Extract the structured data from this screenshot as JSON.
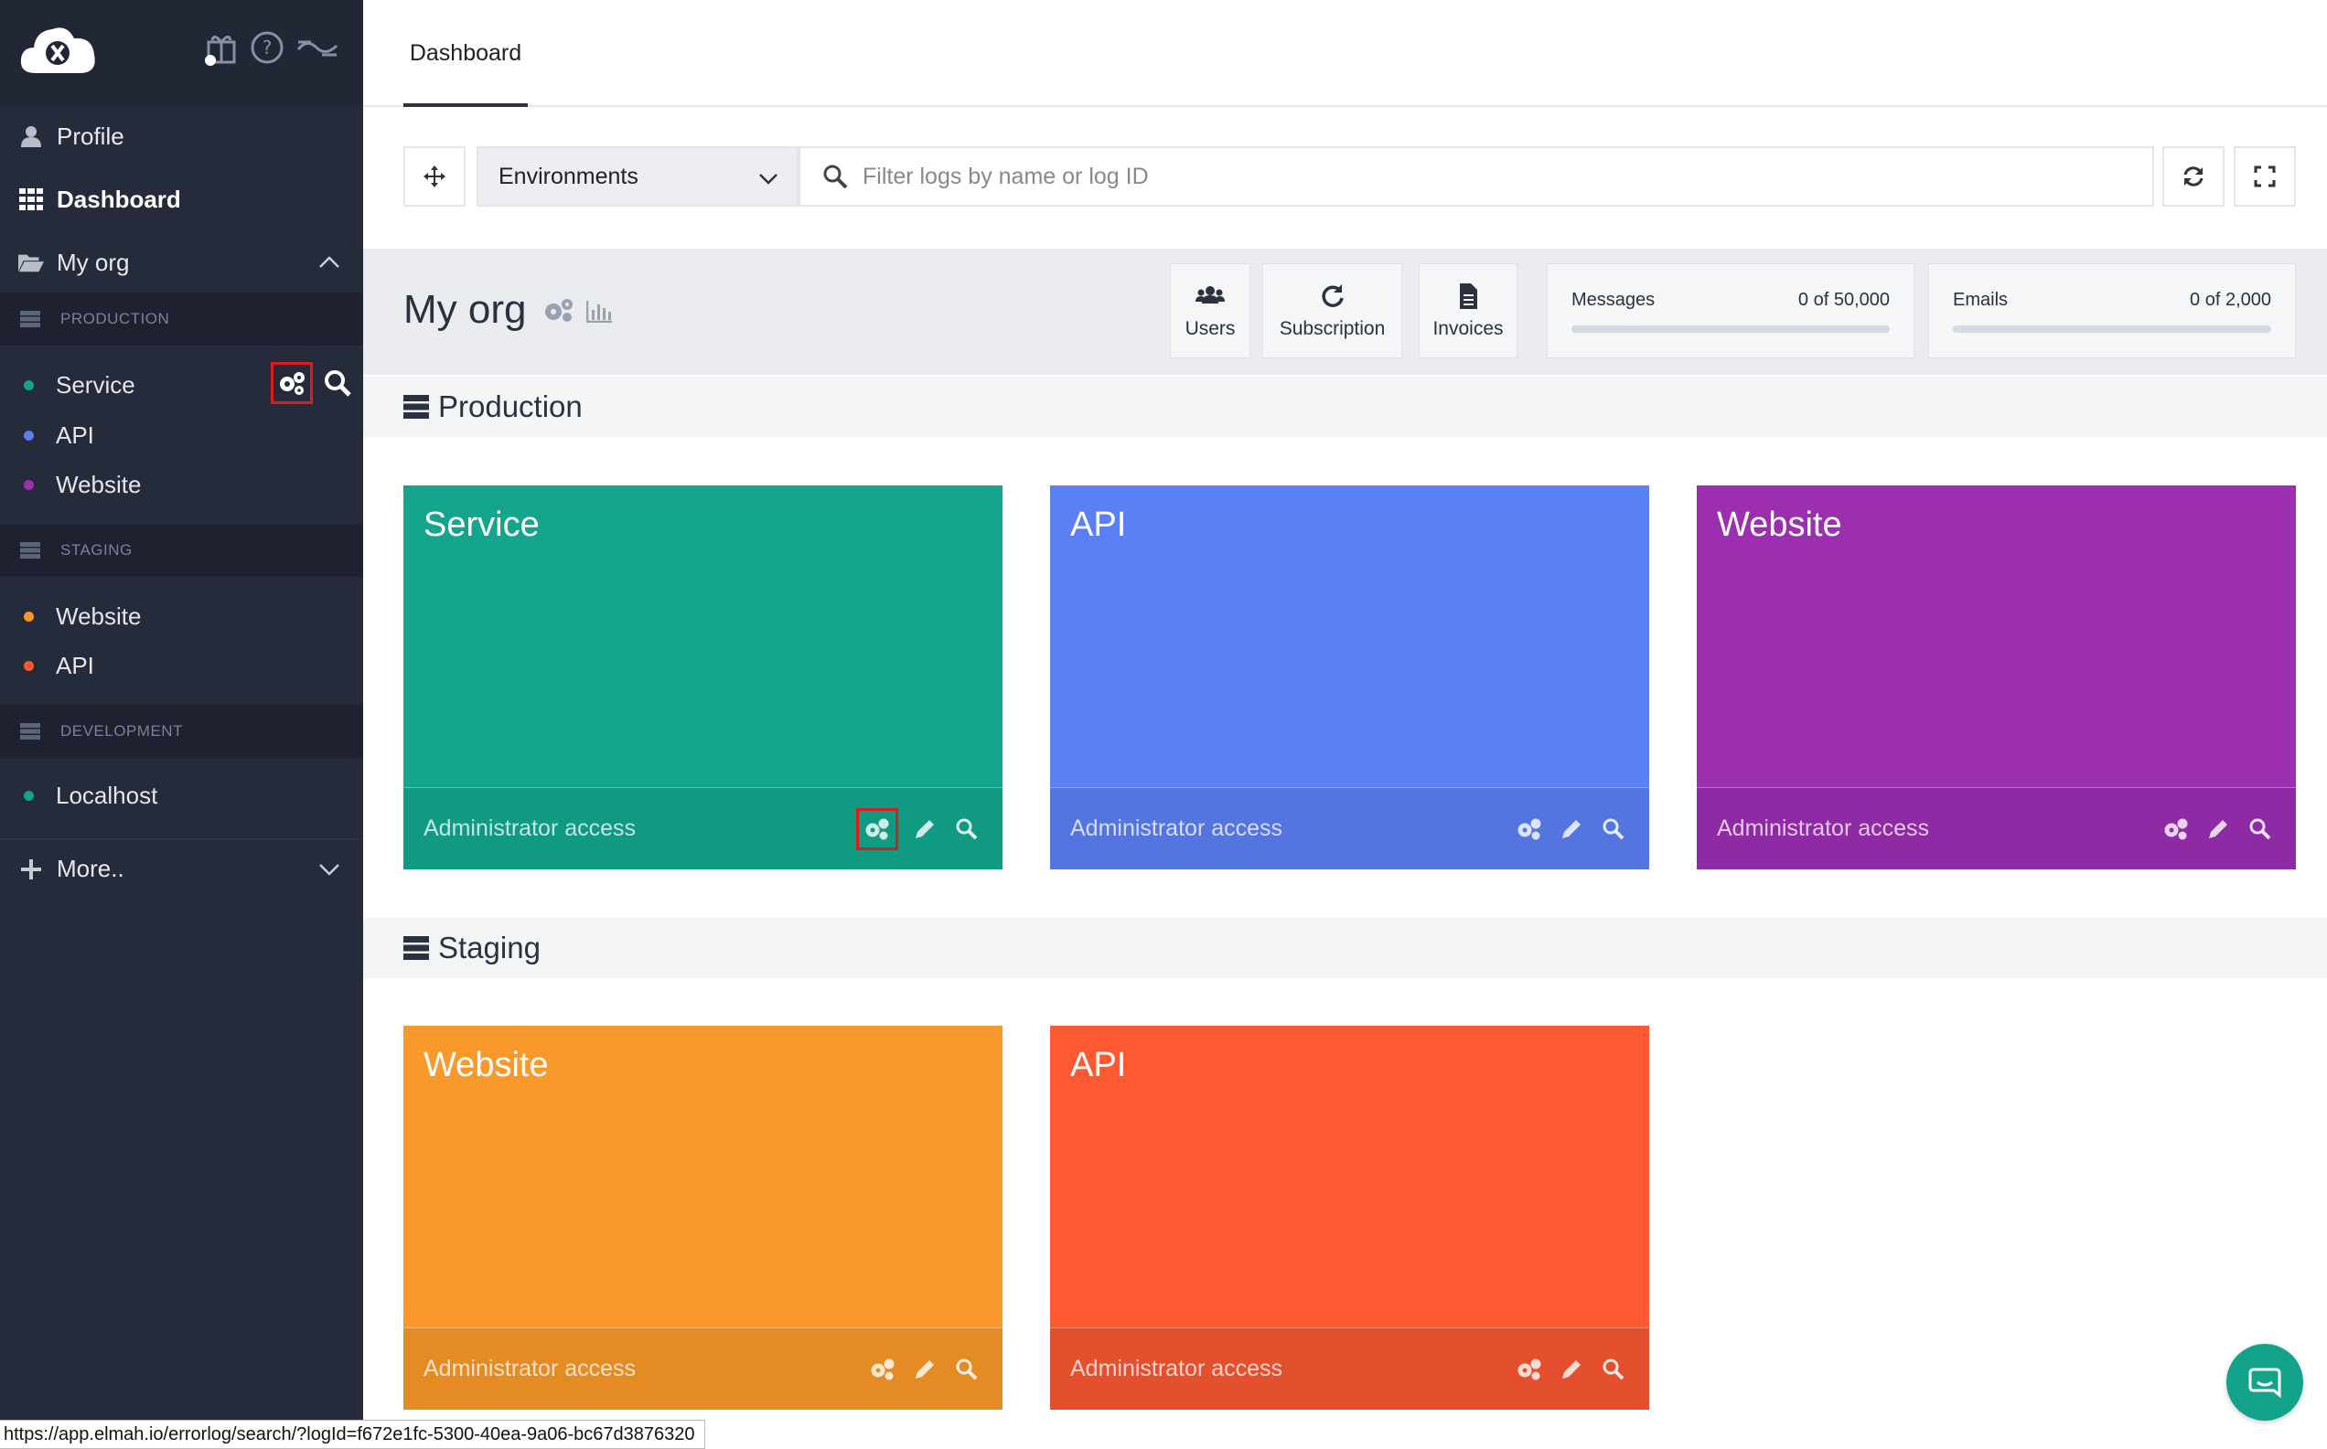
{
  "sidebar": {
    "items": [
      {
        "label": "Profile"
      },
      {
        "label": "Dashboard"
      },
      {
        "label": "My org"
      },
      {
        "label": "More.."
      }
    ],
    "sections": [
      {
        "label": "PRODUCTION",
        "envs": [
          {
            "label": "Service",
            "color": "#13a38a"
          },
          {
            "label": "API",
            "color": "#5b7ff0"
          },
          {
            "label": "Website",
            "color": "#9b30b0"
          }
        ]
      },
      {
        "label": "STAGING",
        "envs": [
          {
            "label": "Website",
            "color": "#f7962a"
          },
          {
            "label": "API",
            "color": "#f25a33"
          }
        ]
      },
      {
        "label": "DEVELOPMENT",
        "envs": [
          {
            "label": "Localhost",
            "color": "#13a38a"
          }
        ]
      }
    ]
  },
  "header": {
    "tab": "Dashboard"
  },
  "toolbar": {
    "environments": "Environments",
    "search_placeholder": "Filter logs by name or log ID"
  },
  "org": {
    "name": "My org",
    "buttons": {
      "users": "Users",
      "subscription": "Subscription",
      "invoices": "Invoices"
    },
    "usage": [
      {
        "label": "Messages",
        "value": "0 of 50,000",
        "fraction": 0
      },
      {
        "label": "Emails",
        "value": "0 of 2,000",
        "fraction": 0
      }
    ]
  },
  "groups": [
    {
      "title": "Production",
      "cards": [
        {
          "title": "Service",
          "access": "Administrator access",
          "color": "#13a68c",
          "footer_color": "#119a82"
        },
        {
          "title": "API",
          "access": "Administrator access",
          "color": "#5b7ff5",
          "footer_color": "#5474e0"
        },
        {
          "title": "Website",
          "access": "Administrator access",
          "color": "#9c2fb0",
          "footer_color": "#8e2aa3"
        }
      ]
    },
    {
      "title": "Staging",
      "cards": [
        {
          "title": "Website",
          "access": "Administrator access",
          "color": "#f9992b",
          "footer_color": "#e58b24"
        },
        {
          "title": "API",
          "access": "Administrator access",
          "color": "#fe5a32",
          "footer_color": "#e4502d"
        }
      ]
    }
  ],
  "status_url": "https://app.elmah.io/errorlog/search/?logId=f672e1fc-5300-40ea-9a06-bc67d3876320",
  "icons": [
    "logo",
    "gift-icon",
    "help-icon",
    "whats-new-icon",
    "user-icon",
    "grid-icon",
    "folder-open-icon",
    "chevron-up-icon",
    "server-icon",
    "gears-icon",
    "search-icon",
    "plus-icon",
    "chevron-down-icon",
    "move-icon",
    "refresh-icon",
    "fullscreen-icon",
    "bar-chart-icon",
    "users-icon",
    "file-icon",
    "pencil-icon",
    "chat-icon"
  ]
}
